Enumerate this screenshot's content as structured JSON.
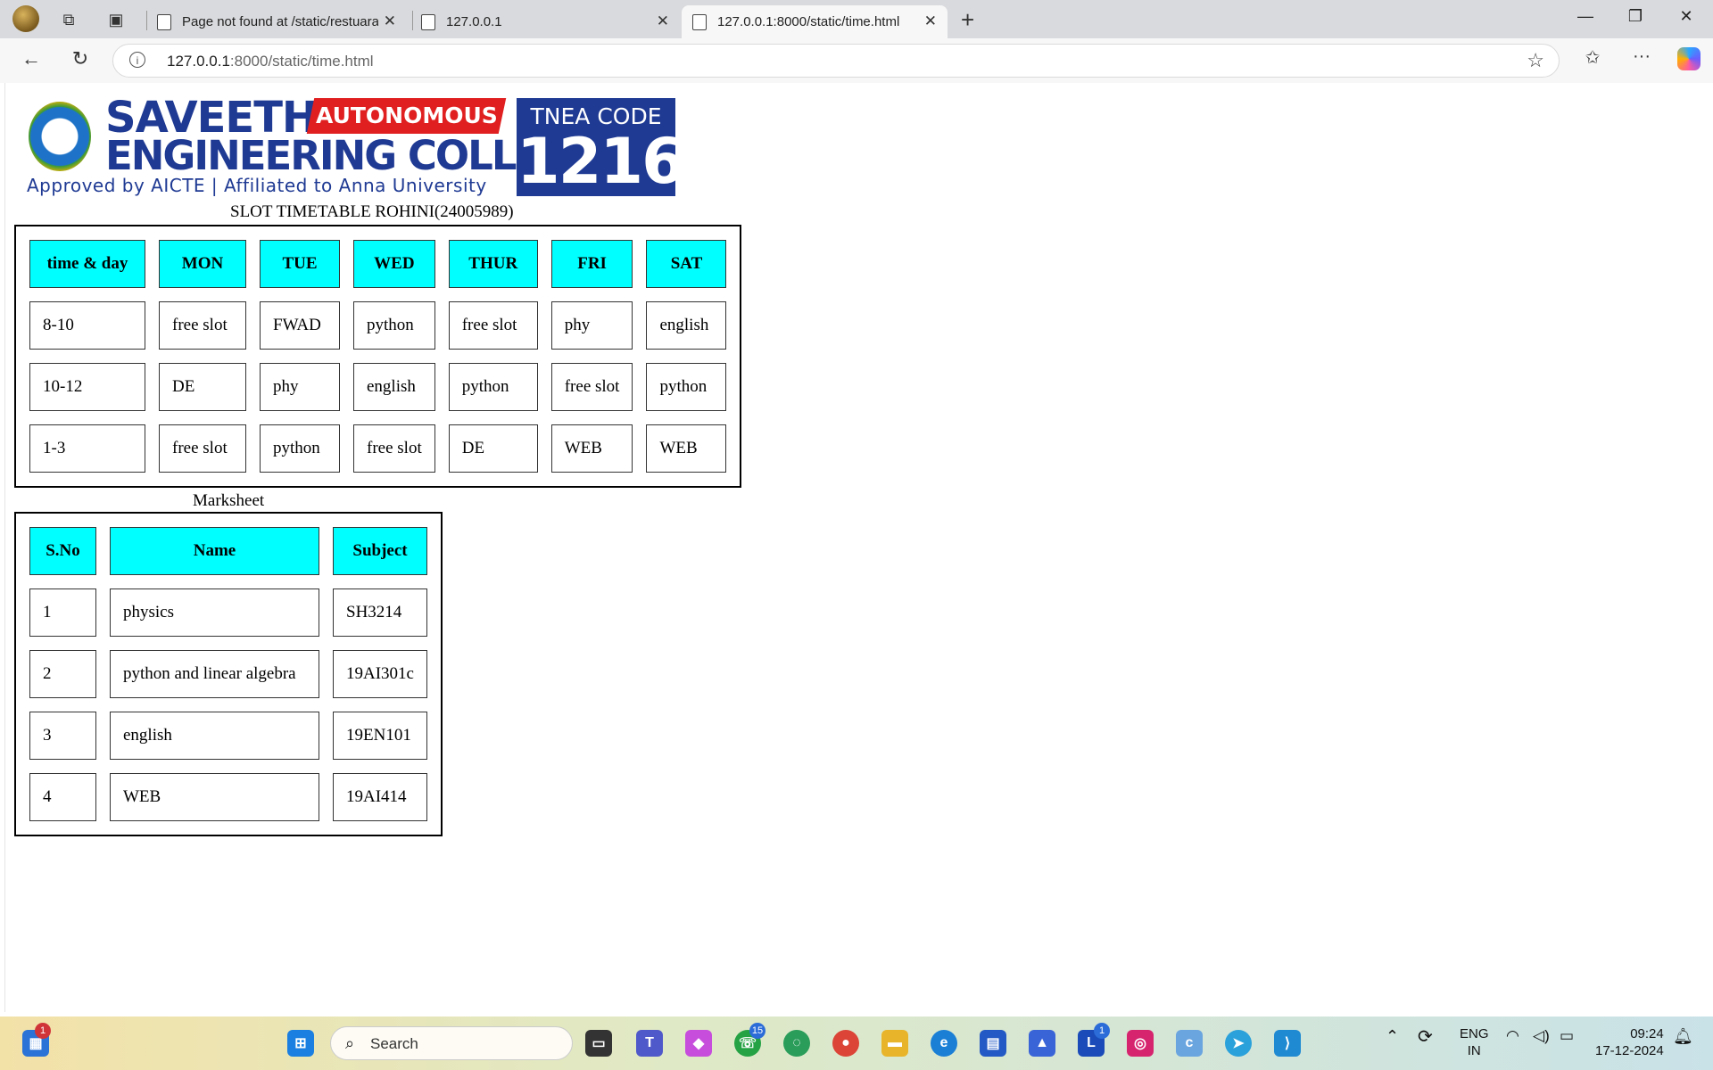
{
  "browser": {
    "tabs": [
      {
        "title": "Page not found at /static/restuara",
        "active": false
      },
      {
        "title": "127.0.0.1",
        "active": false
      },
      {
        "title": "127.0.0.1:8000/static/time.html",
        "active": true
      }
    ],
    "url_host": "127.0.0.1",
    "url_path": ":8000/static/time.html"
  },
  "logo": {
    "brand_line1": "SAVEETHA",
    "brand_line2": "ENGINEERING COLLEGE",
    "autonomous": "AUTONOMOUS",
    "tagline": "Approved by AICTE  |  Affiliated to Anna University",
    "tnea_label": "TNEA CODE",
    "tnea_code": "1216"
  },
  "timetable": {
    "caption": "SLOT TIMETABLE ROHINI(24005989)",
    "headers": [
      "time & day",
      "MON",
      "TUE",
      "WED",
      "THUR",
      "FRI",
      "SAT"
    ],
    "rows": [
      [
        "8-10",
        "free slot",
        "FWAD",
        "python",
        "free slot",
        "phy",
        "english"
      ],
      [
        "10-12",
        "DE",
        "phy",
        "english",
        "python",
        "free slot",
        "python"
      ],
      [
        "1-3",
        "free slot",
        "python",
        "free slot",
        "DE",
        "WEB",
        "WEB"
      ]
    ]
  },
  "marksheet": {
    "caption": "Marksheet",
    "headers": [
      "S.No",
      "Name",
      "Subject"
    ],
    "rows": [
      [
        "1",
        "physics",
        "SH3214"
      ],
      [
        "2",
        "python and linear algebra",
        "19AI301c"
      ],
      [
        "3",
        "english",
        "19EN101"
      ],
      [
        "4",
        "WEB",
        "19AI414"
      ]
    ]
  },
  "taskbar": {
    "search_placeholder": "Search",
    "widgets_badge": "1",
    "whatsapp_badge": "15",
    "l_badge": "1",
    "lang_line1": "ENG",
    "lang_line2": "IN",
    "time": "09:24",
    "date": "17-12-2024"
  }
}
